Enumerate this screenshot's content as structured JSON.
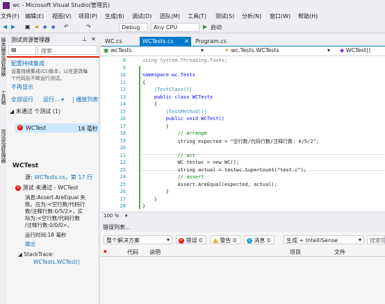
{
  "window": {
    "title": "wc - Microsoft Visual Studio(管理员)"
  },
  "menu": [
    "文件(F)",
    "编辑(E)",
    "视图(V)",
    "项目(P)",
    "生成(B)",
    "调试(D)",
    "团队(M)",
    "工具(T)",
    "测试(S)",
    "分析(N)",
    "窗口(W)",
    "帮助(H)"
  ],
  "toolbar": {
    "config": "Debug",
    "platform": "Any CPU",
    "start": "启动"
  },
  "left_tabs": [
    "服务器资源管理器",
    "工具箱",
    "测试资源管理器"
  ],
  "test_explorer": {
    "title": "测试资源管理器",
    "search_placeholder": "搜索",
    "ci_title": "配置持续集成",
    "ci_desc_1": "设置持续集成(CI)版本，以在更改每",
    "ci_desc_2": "个代码后不断运行测试。",
    "dont_show": "不再显示",
    "run_all": "全部运行",
    "run": "运行...",
    "playlist": "播放列表",
    "group_label": "未通过 个测试 (1)",
    "test_name": "WCTest",
    "test_time": "18 毫秒",
    "detail_title": "WCTest",
    "source_label": "源:",
    "source_link": "WCTests.cs，第 17 行",
    "status": "测试 未通过 - WCTest",
    "message_lines": [
      "消息:Assert.AreEqual 失",
      "败。应为:<空行数/代码行",
      "数/注释行数:0/5/2>，实",
      "际为:<空行数/代码行数",
      "/注释行数:0/0/0>。"
    ],
    "elapsed": "运行时间:18 毫秒",
    "output": "输出",
    "stacktrace_label": "StackTrace:",
    "stacktrace_link": "WCTests.WCTest()"
  },
  "editor": {
    "tabs": [
      "WC.cs",
      "WCTests.cs",
      "Program.cs"
    ],
    "nav_left": "wcTests",
    "nav_mid": "wc.Tests.WCTests",
    "nav_right": "WCTest()",
    "zoom": "100 %"
  },
  "code_lines": [
    {
      "n": "8",
      "text": "using System.Threading.Tasks;"
    },
    {
      "n": "9",
      "text": ""
    },
    {
      "n": "10",
      "text": "namespace wc.Tests"
    },
    {
      "n": "11",
      "text": "{"
    },
    {
      "n": "12",
      "text": "    [TestClass()]"
    },
    {
      "n": "13",
      "text": "    public class WCTests"
    },
    {
      "n": "14",
      "text": "    {"
    },
    {
      "n": "15",
      "text": "        [TestMethod()]"
    },
    {
      "n": "16",
      "text": "        public void WCTest()"
    },
    {
      "n": "17",
      "text": "        {"
    },
    {
      "n": "18",
      "text": "            // arrange"
    },
    {
      "n": "19",
      "text": "            string expected = \"空行数/代码行数/注释行数: 0/5/2\";"
    },
    {
      "n": "20",
      "text": ""
    },
    {
      "n": "21",
      "text": "            // act"
    },
    {
      "n": "22",
      "text": "            WC testwc = new WC();"
    },
    {
      "n": "23",
      "text": "            string actual = testwc.SuperCount(\"test.c\");"
    },
    {
      "n": "24",
      "text": "            // assert"
    },
    {
      "n": "25",
      "text": "            Assert.AreEqual(expected, actual);"
    },
    {
      "n": "26",
      "text": "        }"
    },
    {
      "n": "27",
      "text": "    }"
    },
    {
      "n": "28",
      "text": "}"
    }
  ],
  "error_list": {
    "title": "错误列表...",
    "scope": "整个解决方案",
    "errors": "错误 0",
    "warnings": "警告 0",
    "messages": "消息 0",
    "build": "生成 + IntelliSense",
    "search": "搜索错",
    "columns": [
      "代码",
      "说明",
      "项目",
      "文件"
    ]
  }
}
